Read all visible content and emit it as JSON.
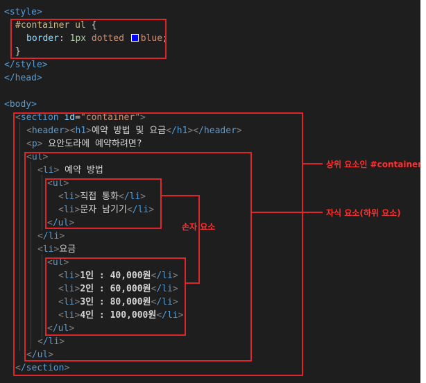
{
  "code": {
    "style_open": "<style>",
    "selector": "#container ul",
    "brace_open": " {",
    "prop": "border",
    "colon": ": ",
    "num": "1px",
    "dotted": " dotted ",
    "color_word": "blue",
    "semicolon": ";",
    "brace_close": "}",
    "style_close": "</style>",
    "head_close": "</head>",
    "body_open": "<body>",
    "section_open_tag": "section",
    "section_attr": "id",
    "section_attr_value": "\"container\"",
    "header_line": {
      "tag1": "header",
      "tag2": "h1",
      "text": "예약 방법 및 요금",
      "close2": "/h1",
      "close1": "/header"
    },
    "p_line": {
      "tag": "p",
      "text": " 요안도라에 예약하려면?"
    },
    "ul_tag": "ul",
    "li_tag": "li",
    "li_close": "/li",
    "ul_close": "/ul",
    "section_close": "/section",
    "item1_text": " 예약 방법",
    "sub1": [
      "직접 통화",
      "문자 남기기"
    ],
    "item2_text": "요금",
    "sub2": [
      "1인 : 40,000원",
      "2인 : 60,000원",
      "3인 : 80,000원",
      "4인 : 100,000원"
    ]
  },
  "annotations": {
    "parent": "상위 요소인 #container",
    "child": "자식 요소(하위 요소)",
    "grandchild": "손자 요소"
  },
  "colors": {
    "highlight": "#e0242c",
    "swatch": "#0000ff"
  }
}
